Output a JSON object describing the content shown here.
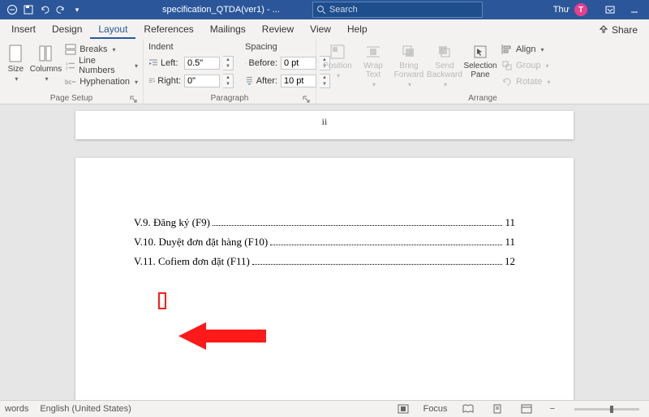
{
  "title": "specification_QTDA(ver1) - ...",
  "search_placeholder": "Search",
  "user_name": "Thư",
  "user_initial": "T",
  "share_label": "Share",
  "tabs": {
    "insert": "Insert",
    "design": "Design",
    "layout": "Layout",
    "references": "References",
    "mailings": "Mailings",
    "review": "Review",
    "view": "View",
    "help": "Help"
  },
  "ribbon": {
    "page_setup": {
      "label": "Page Setup",
      "size": "Size",
      "columns": "Columns",
      "breaks": "Breaks",
      "line_numbers": "Line Numbers",
      "hyphenation": "Hyphenation"
    },
    "paragraph": {
      "label": "Paragraph",
      "indent_hdr": "Indent",
      "spacing_hdr": "Spacing",
      "left_label": "Left:",
      "right_label": "Right:",
      "before_label": "Before:",
      "after_label": "After:",
      "left_val": "0.5\"",
      "right_val": "0\"",
      "before_val": "0 pt",
      "after_val": "10 pt"
    },
    "arrange": {
      "label": "Arrange",
      "position": "Position",
      "wrap": "Wrap\nText",
      "bring": "Bring\nForward",
      "send": "Send\nBackward",
      "selpane": "Selection\nPane",
      "align": "Align",
      "group": "Group",
      "rotate": "Rotate"
    }
  },
  "toc": {
    "page_numeral": "ii",
    "items": [
      {
        "text": "V.9. Đăng ký (F9)",
        "page": "11"
      },
      {
        "text": "V.10. Duyệt đơn đặt hàng (F10)",
        "page": "11"
      },
      {
        "text": "V.11. Cofiem đơn đặt (F11)",
        "page": "12"
      }
    ]
  },
  "status": {
    "words": "words",
    "lang": "English (United States)",
    "focus": "Focus"
  }
}
